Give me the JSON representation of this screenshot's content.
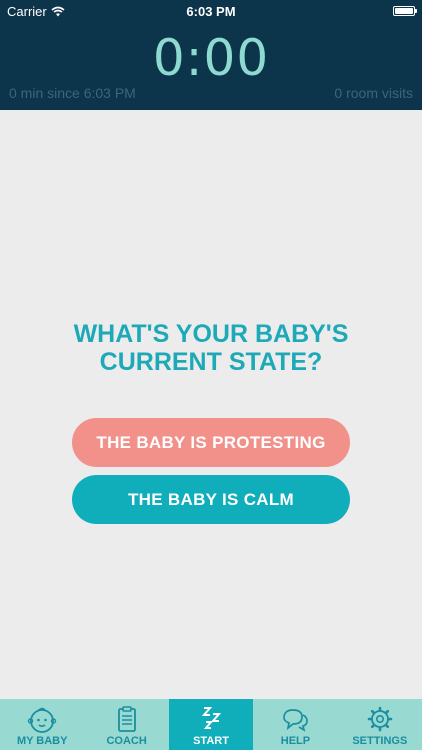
{
  "status_bar": {
    "carrier": "Carrier",
    "time": "6:03 PM"
  },
  "header": {
    "timer": "0:00",
    "since": "0 min since 6:03 PM",
    "room_visits": "0 room visits"
  },
  "main": {
    "question": "WHAT'S YOUR BABY'S CURRENT STATE?",
    "protesting_button": "THE BABY IS PROTESTING",
    "calm_button": "THE BABY IS CALM"
  },
  "tabbar": {
    "items": [
      {
        "label": "MY BABY",
        "icon": "baby-face-icon"
      },
      {
        "label": "COACH",
        "icon": "clipboard-icon"
      },
      {
        "label": "START",
        "icon": "sleep-zzz-icon"
      },
      {
        "label": "HELP",
        "icon": "speech-bubbles-icon"
      },
      {
        "label": "SETTINGS",
        "icon": "gear-icon"
      }
    ],
    "active_index": 2
  },
  "colors": {
    "header_bg": "#0c344b",
    "timer": "#8fdad0",
    "question": "#1ea9b8",
    "protesting": "#f2908a",
    "calm": "#10adbb",
    "tabbar_bg": "#98d9d2"
  }
}
